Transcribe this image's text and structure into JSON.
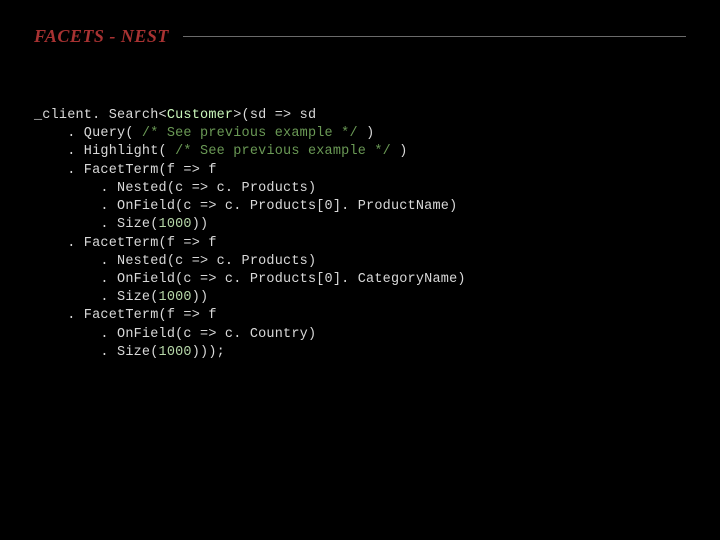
{
  "header": {
    "title": "FACETS - NEST"
  },
  "code": {
    "line1_a": "_client. Search<",
    "line1_type": "Customer",
    "line1_b": ">(sd => sd",
    "line2_a": "    . Query( ",
    "line2_comment": "/* See previous example */",
    "line2_b": " )",
    "line3_a": "    . Highlight( ",
    "line3_comment": "/* See previous example */",
    "line3_b": " )",
    "line4": "    . FacetTerm(f => f",
    "line5": "        . Nested(c => c. Products)",
    "line6": "        . OnField(c => c. Products[0]. ProductName)",
    "line7_a": "        . Size(",
    "line7_num": "1000",
    "line7_b": "))",
    "line8": "    . FacetTerm(f => f",
    "line9": "        . Nested(c => c. Products)",
    "line10": "        . OnField(c => c. Products[0]. CategoryName)",
    "line11_a": "        . Size(",
    "line11_num": "1000",
    "line11_b": "))",
    "line12": "    . FacetTerm(f => f",
    "line13": "        . OnField(c => c. Country)",
    "line14_a": "        . Size(",
    "line14_num": "1000",
    "line14_b": ")));"
  }
}
